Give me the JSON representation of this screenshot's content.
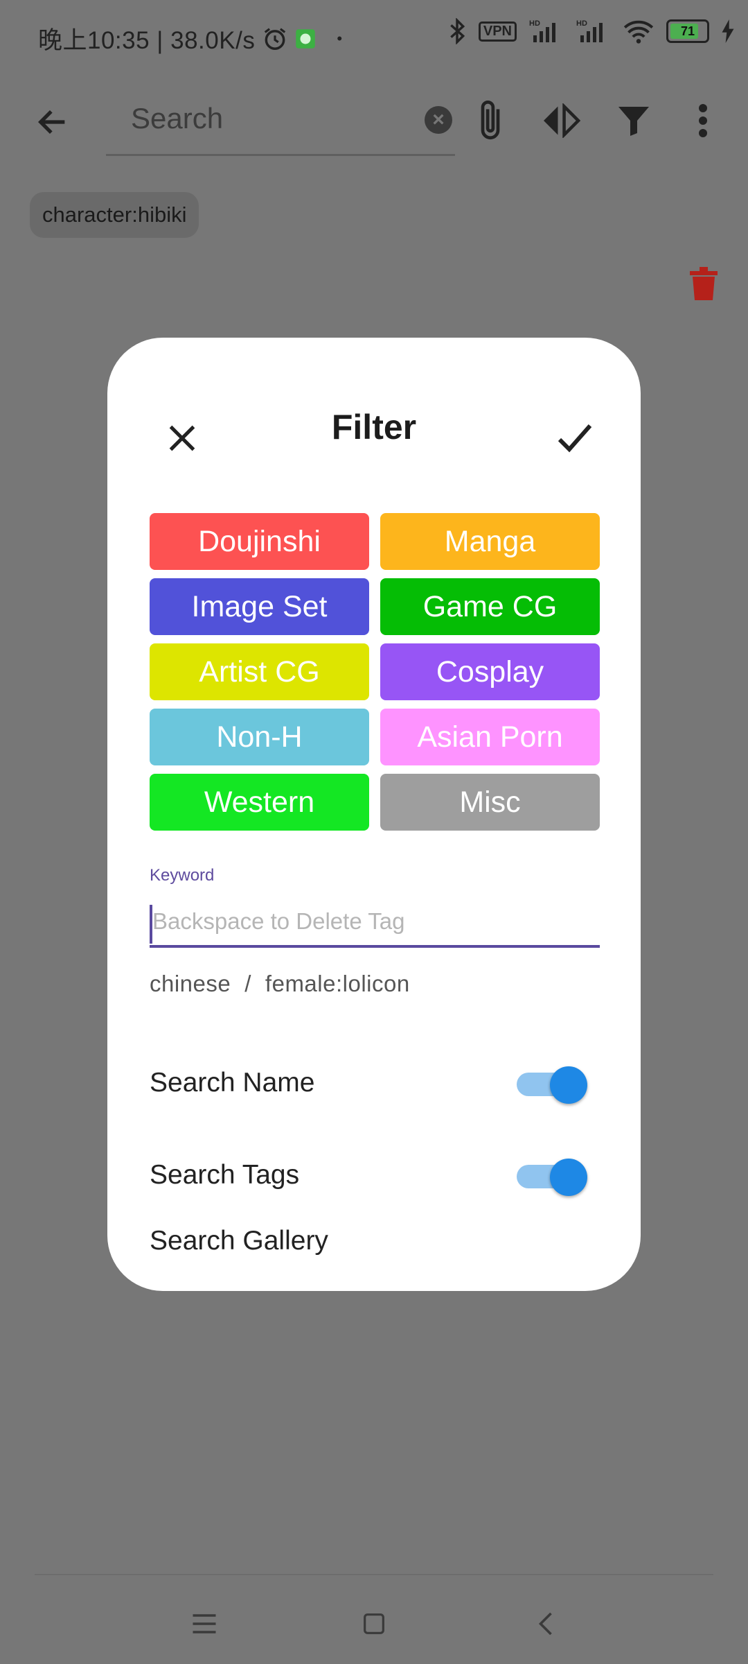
{
  "status_bar": {
    "time_text": "晚上10:35 | 38.0K/s",
    "dot": "•",
    "vpn_label": "VPN",
    "battery_level": "71",
    "icons": [
      "alarm-icon",
      "app-notification-icon",
      "bluetooth-icon",
      "vpn-icon",
      "hd-signal-icon",
      "hd-signal-icon",
      "wifi-icon",
      "battery-icon",
      "charging-icon"
    ]
  },
  "app_bar": {
    "search_placeholder": "Search",
    "icons": [
      "back-arrow-icon",
      "clear-icon",
      "attachment-icon",
      "compare-arrows-icon",
      "filter-icon",
      "more-vert-icon"
    ]
  },
  "chip": {
    "label": "character:hibiki"
  },
  "dialog": {
    "title": "Filter",
    "categories": [
      {
        "label": "Doujinshi",
        "color": "#fd5252"
      },
      {
        "label": "Manga",
        "color": "#fdb51c"
      },
      {
        "label": "Image Set",
        "color": "#5152d9"
      },
      {
        "label": "Game CG",
        "color": "#05bd05"
      },
      {
        "label": "Artist CG",
        "color": "#dde500"
      },
      {
        "label": "Cosplay",
        "color": "#9755f5"
      },
      {
        "label": "Non-H",
        "color": "#6bc6dc"
      },
      {
        "label": "Asian Porn",
        "color": "#fe93ff"
      },
      {
        "label": "Western",
        "color": "#14e723"
      },
      {
        "label": "Misc",
        "color": "#9e9e9e"
      }
    ],
    "keyword_label": "Keyword",
    "keyword_placeholder": "Backspace to Delete Tag",
    "selected_tags": [
      "chinese",
      "female:lolicon"
    ],
    "tag_separator": "/",
    "settings": [
      {
        "label": "Search Name",
        "enabled": true
      },
      {
        "label": "Search Tags",
        "enabled": true
      },
      {
        "label": "Search Gallery",
        "enabled": true
      }
    ]
  },
  "colors": {
    "scrim": "#777777",
    "accent": "#5a4a9f",
    "toggle_on": "#1e88e5",
    "delete": "#b5211a"
  }
}
